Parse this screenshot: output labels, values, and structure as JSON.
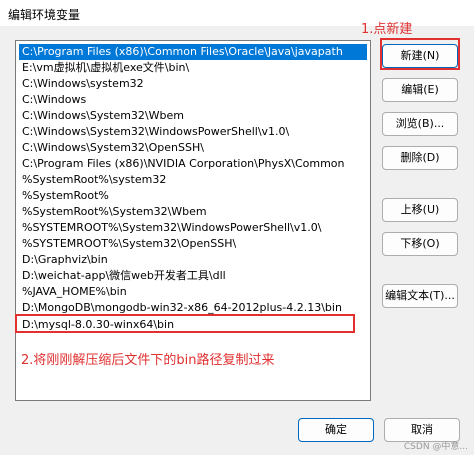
{
  "window": {
    "title": "编辑环境变量"
  },
  "paths": [
    "C:\\Program Files (x86)\\Common Files\\Oracle\\Java\\javapath",
    "E:\\vm虚拟机\\虚拟机exe文件\\bin\\",
    "C:\\Windows\\system32",
    "C:\\Windows",
    "C:\\Windows\\System32\\Wbem",
    "C:\\Windows\\System32\\WindowsPowerShell\\v1.0\\",
    "C:\\Windows\\System32\\OpenSSH\\",
    "C:\\Program Files (x86)\\NVIDIA Corporation\\PhysX\\Common",
    "%SystemRoot%\\system32",
    "%SystemRoot%",
    "%SystemRoot%\\System32\\Wbem",
    "%SYSTEMROOT%\\System32\\WindowsPowerShell\\v1.0\\",
    "%SYSTEMROOT%\\System32\\OpenSSH\\",
    "D:\\Graphviz\\bin",
    "D:\\weichat-app\\微信web开发者工具\\dll",
    "%JAVA_HOME%\\bin",
    "D:\\MongoDB\\mongodb-win32-x86_64-2012plus-4.2.13\\bin",
    "D:\\mysql-8.0.30-winx64\\bin"
  ],
  "buttons": {
    "new": "新建(N)",
    "edit": "编辑(E)",
    "browse": "浏览(B)...",
    "delete": "删除(D)",
    "move_up": "上移(U)",
    "move_down": "下移(O)",
    "edit_text": "编辑文本(T)...",
    "ok": "确定",
    "cancel": "取消"
  },
  "annotations": {
    "step1": "1.点新建",
    "step2": "2.将刚刚解压缩后文件下的bin路径复制过来"
  },
  "watermark": "CSDN @中意...",
  "colors": {
    "selection": "#0078d7",
    "annotation": "#e03030"
  }
}
